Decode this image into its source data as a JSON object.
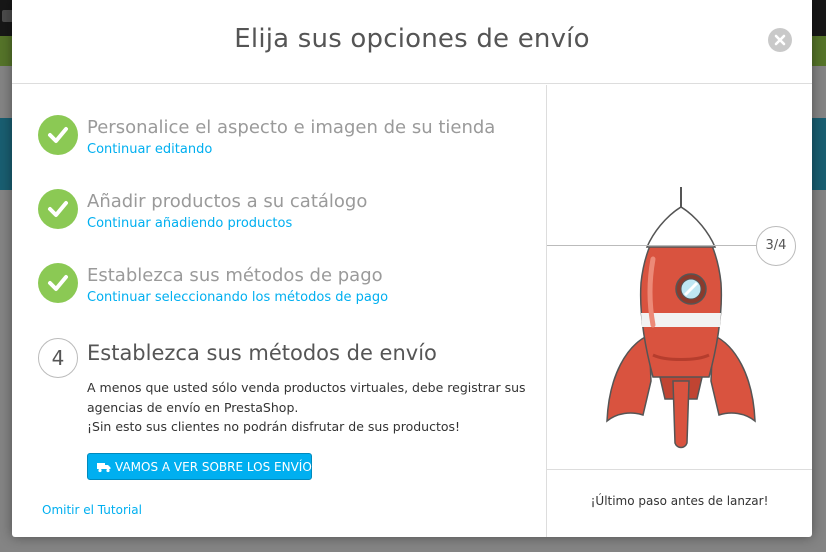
{
  "modal": {
    "title": "Elija sus opciones de envío",
    "close_icon": "close-circle-icon"
  },
  "steps": [
    {
      "title": "Personalice el aspecto e imagen de su tienda",
      "link": "Continuar editando",
      "status": "done"
    },
    {
      "title": "Añadir productos a su catálogo",
      "link": "Continuar añadiendo productos",
      "status": "done"
    },
    {
      "title": "Establezca sus métodos de pago",
      "link": "Continuar seleccionando los métodos de pago",
      "status": "done"
    }
  ],
  "current_step": {
    "number": "4",
    "title": "Establezca sus métodos de envío",
    "description_1": "A menos que usted sólo venda productos virtuales, debe registrar sus",
    "description_2": "agencias de envío en PrestaShop.",
    "description_3": "¡Sin esto sus clientes no podrán disfrutar de sus productos!",
    "button_label": "VAMOS A VER SOBRE LOS ENVÍOS",
    "button_icon": "truck-icon"
  },
  "skip_label": "Omitir el Tutorial",
  "progress": {
    "label": "3/4",
    "completed": 3,
    "total": 4
  },
  "right_footer": "¡Último paso antes de lanzar!",
  "colors": {
    "accent": "#00aff0",
    "success": "#8bc954",
    "rocket": "#d9533f"
  }
}
